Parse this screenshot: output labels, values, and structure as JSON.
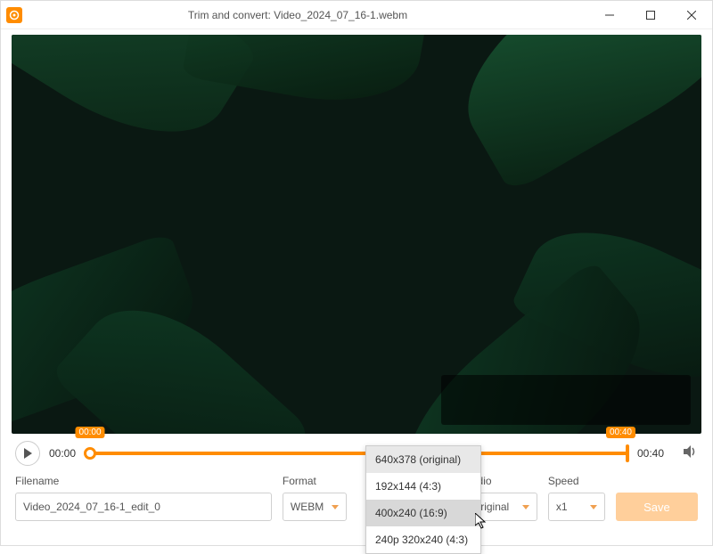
{
  "window": {
    "title": "Trim and convert: Video_2024_07_16-1.webm"
  },
  "playback": {
    "current_time": "00:00",
    "end_time": "00:40",
    "badge_start": "00:00",
    "badge_end": "00:40"
  },
  "fields": {
    "filename_label": "Filename",
    "filename_value": "Video_2024_07_16-1_edit_0",
    "format_label": "Format",
    "format_value": "WEBM",
    "audio_label": "Audio",
    "audio_value": "Original",
    "speed_label": "Speed",
    "speed_value": "x1",
    "save_label": "Save"
  },
  "size_dropdown": {
    "items": [
      "640x378 (original)",
      "192x144 (4:3)",
      "400x240 (16:9)",
      "240p 320x240 (4:3)"
    ],
    "highlighted_index": 2
  },
  "colors": {
    "accent": "#ff8c00"
  }
}
